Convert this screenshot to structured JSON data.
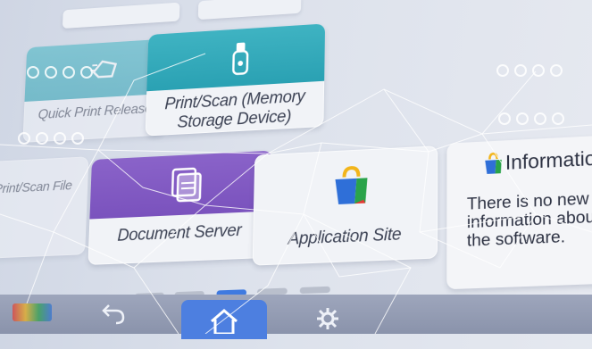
{
  "tiles": {
    "quick_print": "Quick Print Release",
    "print_scan_line1": "Print/Scan (Memory",
    "print_scan_line2": "Storage Device)",
    "document_server": "Document Server",
    "application_site": "Application Site",
    "edge_left": "Print/Scan File"
  },
  "info": {
    "title": "Information",
    "message": "There is no new information about the software."
  },
  "pager": {
    "pages": 4,
    "active": 2
  },
  "colors": {
    "teal": "#2aa1b3",
    "purple": "#7a52bd",
    "home_blue": "#4d7fe0"
  }
}
